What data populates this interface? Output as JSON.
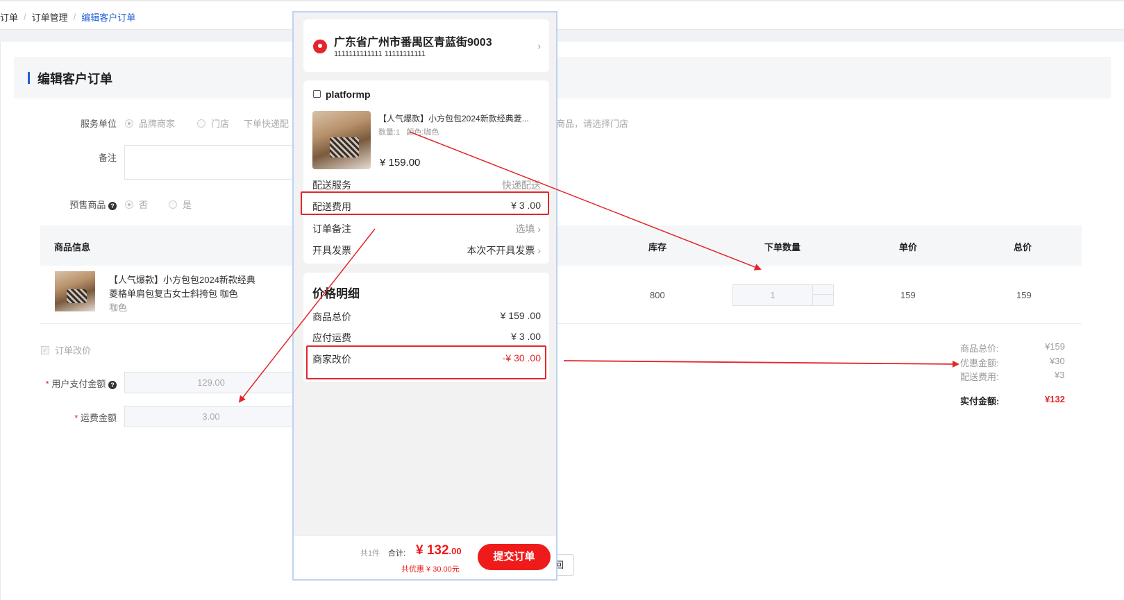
{
  "breadcrumb": {
    "items": [
      "订单",
      "订单管理"
    ],
    "sep": "/",
    "current": "编辑客户订单"
  },
  "section_title": "编辑客户订单",
  "form": {
    "service_unit": {
      "label": "服务单位",
      "options": [
        "品牌商家",
        "门店"
      ],
      "selected": "品牌商家",
      "extra": "下单快递配",
      "hint": "商品，请选择门店"
    },
    "remark": {
      "label": "备注",
      "value": ""
    },
    "presale": {
      "label": "预售商品",
      "options": [
        "否",
        "是"
      ],
      "selected": "否"
    }
  },
  "table": {
    "headers": [
      "商品信息",
      "库存",
      "下单数量",
      "单价",
      "总价"
    ],
    "rows": [
      {
        "name_line1": "【人气爆款】小方包包2024新款经典",
        "name_line2": "菱格单肩包复古女士斜挎包 咖色",
        "spec": "咖色",
        "stock": "800",
        "qty": "1",
        "price": "159",
        "total": "159"
      }
    ]
  },
  "modify": {
    "checkbox_label": "订单改价",
    "user_pay_label": "用户支付金额",
    "user_pay_value": "129.00",
    "shipping_label": "运费金额",
    "shipping_value": "3.00",
    "required_mark": "*"
  },
  "summary": {
    "goods_total_label": "商品总价:",
    "goods_total": "¥159",
    "discount_label": "优惠金额:",
    "discount": "¥30",
    "shipping_label": "配送费用:",
    "shipping": "¥3",
    "paid_label": "实付金额:",
    "paid": "¥132"
  },
  "back_button_partial": "回",
  "phone": {
    "address": {
      "title": "广东省广州市番禺区青蓝街9003",
      "contact": "1111111111111 11111111111"
    },
    "shop_name": "platformp",
    "product": {
      "title": "【人气爆款】小方包包2024新款经典菱...",
      "meta": "数量:1   颜色:咖色",
      "price": "¥ 159.00"
    },
    "rows": [
      {
        "k": "配送服务",
        "v": "快递配送"
      },
      {
        "k": "配送费用",
        "v": "¥ 3 .00"
      },
      {
        "k": "订单备注",
        "v": "选填"
      },
      {
        "k": "开具发票",
        "v": "本次不开具发票"
      }
    ],
    "price_detail": {
      "title": "价格明细",
      "goods_total_k": "商品总价",
      "goods_total_v": "¥ 159 .00",
      "freight_k": "应付运费",
      "freight_v": "¥ 3 .00",
      "merchant_k": "商家改价",
      "merchant_v": "-¥ 30 .00"
    },
    "footer": {
      "count": "共1件",
      "total_label": "合计:",
      "total_int": "¥ 132",
      "total_dec": ".00",
      "saving": "共优惠 ¥ 30.00元",
      "submit": "提交订单"
    }
  },
  "colors": {
    "accent_blue": "#1f5fd6",
    "highlight_red": "#e3262b",
    "price_red": "#ef1b1b"
  }
}
